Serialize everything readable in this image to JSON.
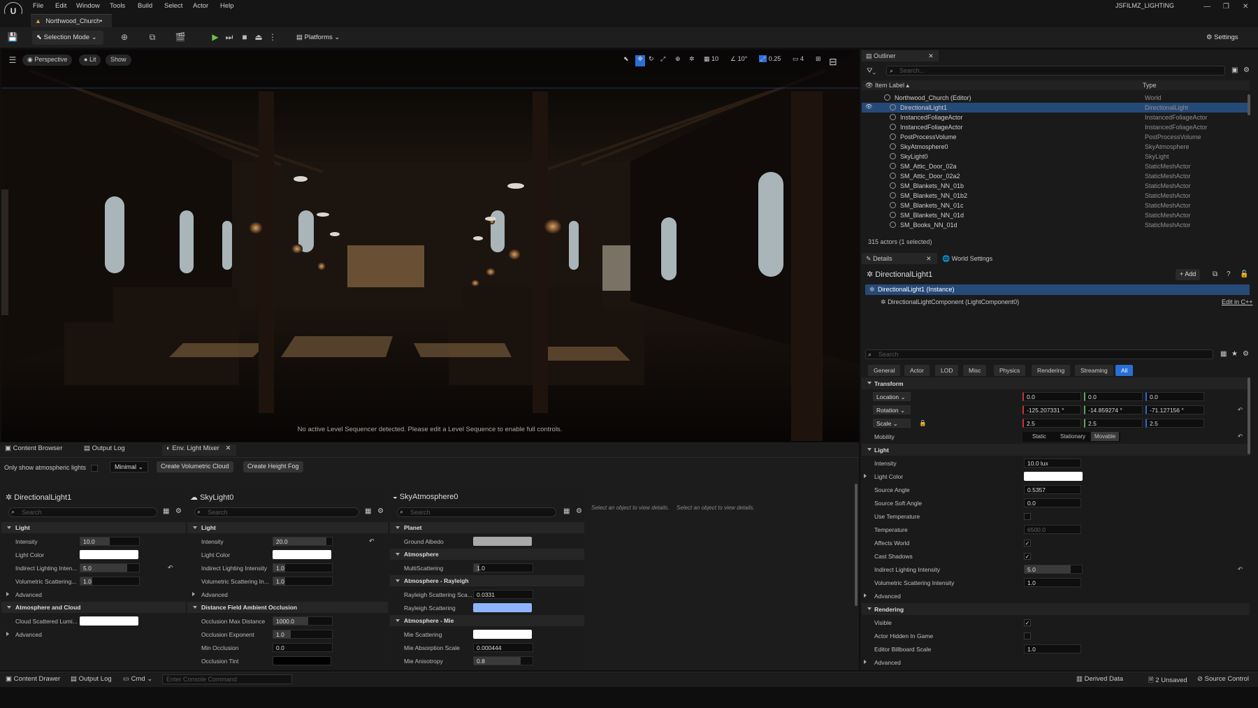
{
  "app": {
    "project_name": "JSFILMZ_LIGHTING",
    "doc_tab": "Northwood_Church•"
  },
  "menu": [
    "File",
    "Edit",
    "Window",
    "Tools",
    "Build",
    "Select",
    "Actor",
    "Help"
  ],
  "toolbar": {
    "selection_mode": "Selection Mode",
    "platforms": "Platforms",
    "settings": "Settings"
  },
  "viewport": {
    "perspective": "Perspective",
    "lit": "Lit",
    "show": "Show",
    "grid_value": "10",
    "angle_value": "10°",
    "scale_value": "0.25",
    "camera_speed": "4",
    "sequencer_message": "No active Level Sequencer detected. Please edit a Level Sequence to enable full controls."
  },
  "lower_tabs": [
    "Content Browser",
    "Output Log",
    "Env. Light Mixer"
  ],
  "mixer": {
    "only_show_label": "Only show atmospheric lights",
    "minimal": "Minimal",
    "create_cloud": "Create Volumetric Cloud",
    "create_fog": "Create Height Fog",
    "search_placeholder": "Search",
    "empty_message_1": "Select an object to view details.",
    "empty_message_2": "Select an object to view details.",
    "dl": {
      "title": "DirectionalLight1",
      "light": "Light",
      "intensity_label": "Intensity",
      "intensity_value": "10.0",
      "intensity_fill": 0.5,
      "light_color_label": "Light Color",
      "light_color": "#ffffff",
      "indirect_label": "Indirect Lighting Inten...",
      "indirect_value": "5.0",
      "indirect_fill": 0.8,
      "volumetric_label": "Volumetric Scattering...",
      "volumetric_value": "1.0",
      "volumetric_fill": 0.2,
      "advanced": "Advanced",
      "atmosphere_cloud": "Atmosphere and Cloud",
      "cloud_lumi_label": "Cloud Scattered Lumi...",
      "cloud_lumi_color": "#ffffff",
      "advanced2": "Advanced"
    },
    "sky": {
      "title": "SkyLight0",
      "light": "Light",
      "intensity_label": "Intensity",
      "intensity_value": "20.0",
      "intensity_fill": 0.9,
      "light_color_label": "Light Color",
      "light_color": "#ffffff",
      "indirect_label": "Indirect Lighting Intensity",
      "indirect_value": "1.0",
      "indirect_fill": 0.2,
      "volumetric_label": "Volumetric Scattering In...",
      "volumetric_value": "1.0",
      "volumetric_fill": 0.2,
      "advanced": "Advanced",
      "dfao": "Distance Field Ambient Occlusion",
      "occ_max_label": "Occlusion Max Distance",
      "occ_max_value": "1000.0",
      "occ_max_fill": 0.6,
      "occ_exp_label": "Occlusion Exponent",
      "occ_exp_value": "1.0",
      "occ_exp_fill": 0.3,
      "min_occ_label": "Min Occlusion",
      "min_occ_value": "0.0",
      "occ_tint_label": "Occlusion Tint",
      "occ_tint_color": "#000000"
    },
    "atmo": {
      "title": "SkyAtmosphere0",
      "planet": "Planet",
      "ground_albedo_label": "Ground Albedo",
      "ground_albedo_color": "#a9a9a9",
      "atmosphere": "Atmosphere",
      "multiscattering_label": "MultiScattering",
      "multiscattering_value": "1.0",
      "multiscattering_fill": 0.1,
      "rayleigh": "Atmosphere - Rayleigh",
      "rayleigh_scale_label": "Rayleigh Scattering Sca...",
      "rayleigh_scale_value": "0.0331",
      "rayleigh_scat_label": "Rayleigh Scattering",
      "rayleigh_color": "#8fb4ff",
      "mie": "Atmosphere - Mie",
      "mie_scat_label": "Mie Scattering",
      "mie_color": "#ffffff",
      "mie_abs_label": "Mie Absorption Scale",
      "mie_abs_value": "0.000444",
      "mie_aniso_label": "Mie Anisotropy",
      "mie_aniso_value": "0.8",
      "mie_aniso_fill": 0.8
    }
  },
  "outliner": {
    "title": "Outliner",
    "search_placeholder": "Search...",
    "col_label": "Item Label ▴",
    "col_type": "Type",
    "items": [
      {
        "label": "Northwood_Church (Editor)",
        "type": "World"
      },
      {
        "label": "DirectionalLight1",
        "type": "DirectionalLight"
      },
      {
        "label": "InstancedFoliageActor",
        "type": "InstancedFoliageActor"
      },
      {
        "label": "InstancedFoliageActor",
        "type": "InstancedFoliageActor"
      },
      {
        "label": "PostProcessVolume",
        "type": "PostProcessVolume"
      },
      {
        "label": "SkyAtmosphere0",
        "type": "SkyAtmosphere"
      },
      {
        "label": "SkyLight0",
        "type": "SkyLight"
      },
      {
        "label": "SM_Attic_Door_02a",
        "type": "StaticMeshActor"
      },
      {
        "label": "SM_Attic_Door_02a2",
        "type": "StaticMeshActor"
      },
      {
        "label": "SM_Blankets_NN_01b",
        "type": "StaticMeshActor"
      },
      {
        "label": "SM_Blankets_NN_01b2",
        "type": "StaticMeshActor"
      },
      {
        "label": "SM_Blankets_NN_01c",
        "type": "StaticMeshActor"
      },
      {
        "label": "SM_Blankets_NN_01d",
        "type": "StaticMeshActor"
      },
      {
        "label": "SM_Books_NN_01d",
        "type": "StaticMeshActor"
      }
    ],
    "footer": "315 actors (1 selected)"
  },
  "details": {
    "tab": "Details",
    "world_settings_tab": "World Settings",
    "actor_name": "DirectionalLight1",
    "add_button": "Add",
    "instance_row": "DirectionalLight1 (Instance)",
    "component_row": "DirectionalLightComponent (LightComponent0)",
    "edit_cpp": "Edit in C++",
    "search_placeholder": "Search",
    "filter_tabs": [
      "General",
      "Actor",
      "LOD",
      "Misc",
      "Physics",
      "Rendering",
      "Streaming",
      "All"
    ],
    "transform": "Transform",
    "location_label": "Location",
    "location": [
      "0.0",
      "0.0",
      "0.0"
    ],
    "rotation_label": "Rotation",
    "rotation": [
      "-125.207331 °",
      "-14.859274 °",
      "-71.127156 °"
    ],
    "scale_label": "Scale",
    "scale": [
      "2.5",
      "2.5",
      "2.5"
    ],
    "mobility_label": "Mobility",
    "mobility_options": [
      "Static",
      "Stationary",
      "Movable"
    ],
    "light": "Light",
    "intensity_label": "Intensity",
    "intensity_value": "10.0 lux",
    "light_color_label": "Light Color",
    "light_color": "#ffffff",
    "source_angle_label": "Source Angle",
    "source_angle_value": "0.5357",
    "source_soft_label": "Source Soft Angle",
    "source_soft_value": "0.0",
    "use_temp_label": "Use Temperature",
    "temperature_label": "Temperature",
    "temperature_value": "6500.0",
    "affects_world_label": "Affects World",
    "cast_shadows_label": "Cast Shadows",
    "indirect_label": "Indirect Lighting Intensity",
    "indirect_value": "5.0",
    "indirect_fill": 0.8,
    "volumetric_label": "Volumetric Scattering Intensity",
    "volumetric_value": "1.0",
    "advanced": "Advanced",
    "rendering": "Rendering",
    "visible_label": "Visible",
    "hidden_label": "Actor Hidden In Game",
    "billboard_label": "Editor Billboard Scale",
    "billboard_value": "1.0",
    "advanced2": "Advanced"
  },
  "statusbar": {
    "content_drawer": "Content Drawer",
    "output_log": "Output Log",
    "cmd": "Cmd",
    "console_placeholder": "Enter Console Command",
    "derived_data": "Derived Data",
    "unsaved": "2 Unsaved",
    "source_control": "Source Control"
  },
  "colors": {
    "accent_blue": "#2a6fd6",
    "selection": "#264a78",
    "play_green": "#6cc24a"
  }
}
